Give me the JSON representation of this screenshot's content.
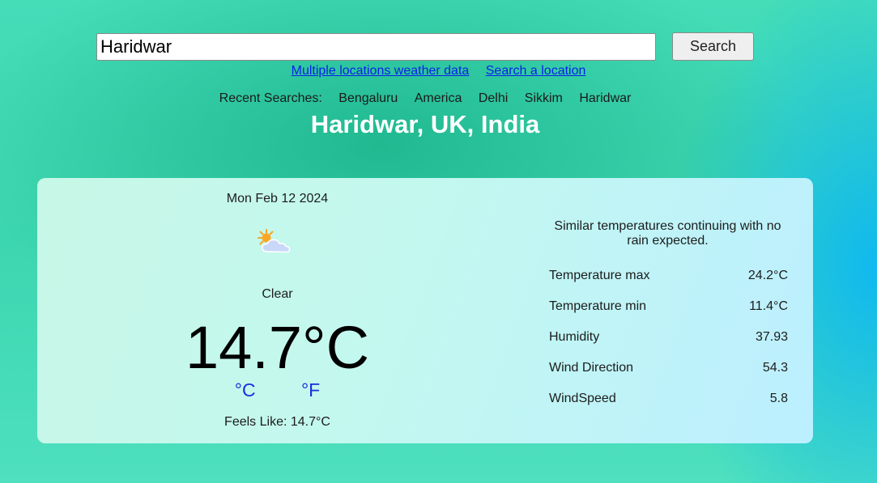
{
  "search": {
    "value": "Haridwar",
    "button_label": "Search"
  },
  "links": {
    "multiple": "Multiple locations weather data",
    "search_location": "Search a location"
  },
  "recent": {
    "label": "Recent Searches:",
    "items": [
      "Bengaluru",
      "America",
      "Delhi",
      "Sikkim",
      "Haridwar"
    ]
  },
  "location": {
    "title": "Haridwar, UK, India"
  },
  "current": {
    "date": "Mon Feb 12 2024",
    "icon": "partly-cloudy-icon",
    "condition": "Clear",
    "temperature": "14.7°C",
    "unit_c": "°C",
    "unit_f": "°F",
    "feels_like": "Feels Like: 14.7°C"
  },
  "summary": "Similar temperatures continuing with no rain expected.",
  "stats": [
    {
      "label": "Temperature max",
      "value": "24.2°C"
    },
    {
      "label": "Temperature min",
      "value": "11.4°C"
    },
    {
      "label": "Humidity",
      "value": "37.93"
    },
    {
      "label": "Wind Direction",
      "value": "54.3"
    },
    {
      "label": "WindSpeed",
      "value": "5.8"
    }
  ],
  "colors": {
    "link": "#0b1fe8",
    "unit_link": "#1a2ddb",
    "title": "#ffffff",
    "background": "#3cd6b0"
  }
}
